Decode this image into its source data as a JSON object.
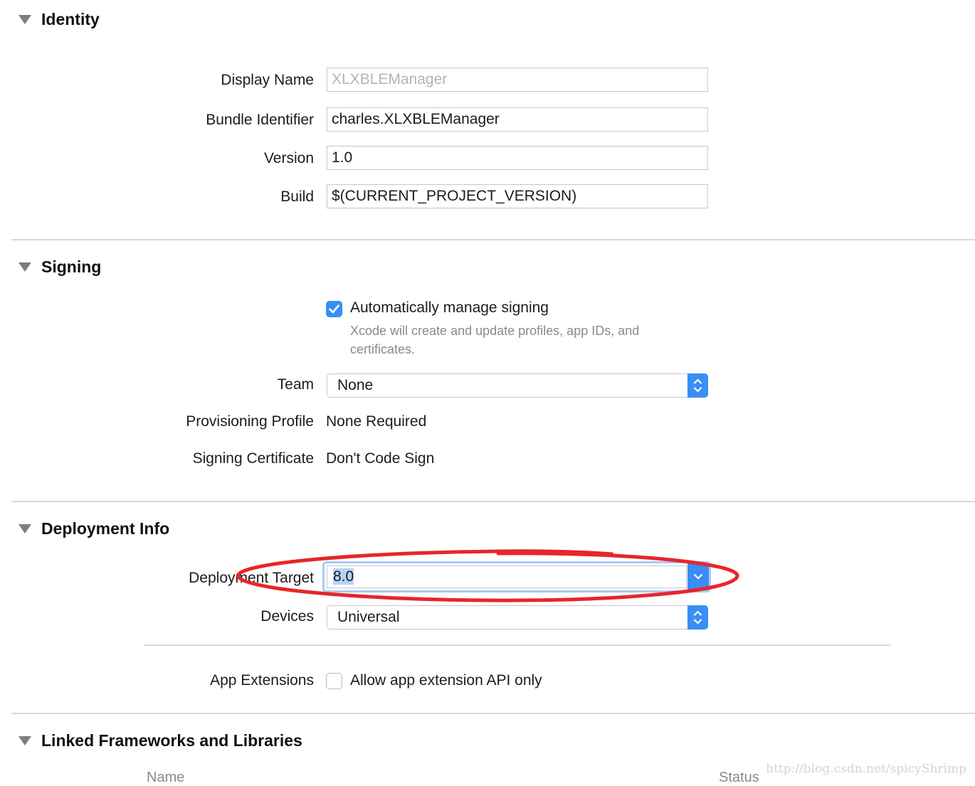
{
  "identity": {
    "title": "Identity",
    "display_name_label": "Display Name",
    "display_name_value": "XLXBLEManager",
    "bundle_id_label": "Bundle Identifier",
    "bundle_id_value": "charles.XLXBLEManager",
    "version_label": "Version",
    "version_value": "1.0",
    "build_label": "Build",
    "build_value": "$(CURRENT_PROJECT_VERSION)"
  },
  "signing": {
    "title": "Signing",
    "auto_manage_label": "Automatically manage signing",
    "auto_manage_checked": true,
    "auto_manage_help": "Xcode will create and update profiles, app IDs, and certificates.",
    "team_label": "Team",
    "team_value": "None",
    "profile_label": "Provisioning Profile",
    "profile_value": "None Required",
    "certificate_label": "Signing Certificate",
    "certificate_value": "Don't Code Sign"
  },
  "deployment": {
    "title": "Deployment Info",
    "target_label": "Deployment Target",
    "target_value": "8.0",
    "devices_label": "Devices",
    "devices_value": "Universal",
    "extensions_label": "App Extensions",
    "extensions_option_label": "Allow app extension API only",
    "extensions_checked": false
  },
  "frameworks": {
    "title": "Linked Frameworks and Libraries",
    "col_name": "Name",
    "col_status": "Status"
  },
  "watermark": "http://blog.csdn.net/spicyShrimp",
  "colors": {
    "accent": "#3a8ef6",
    "highlight_circle": "#e8252b",
    "selection": "#b3d4fc"
  }
}
